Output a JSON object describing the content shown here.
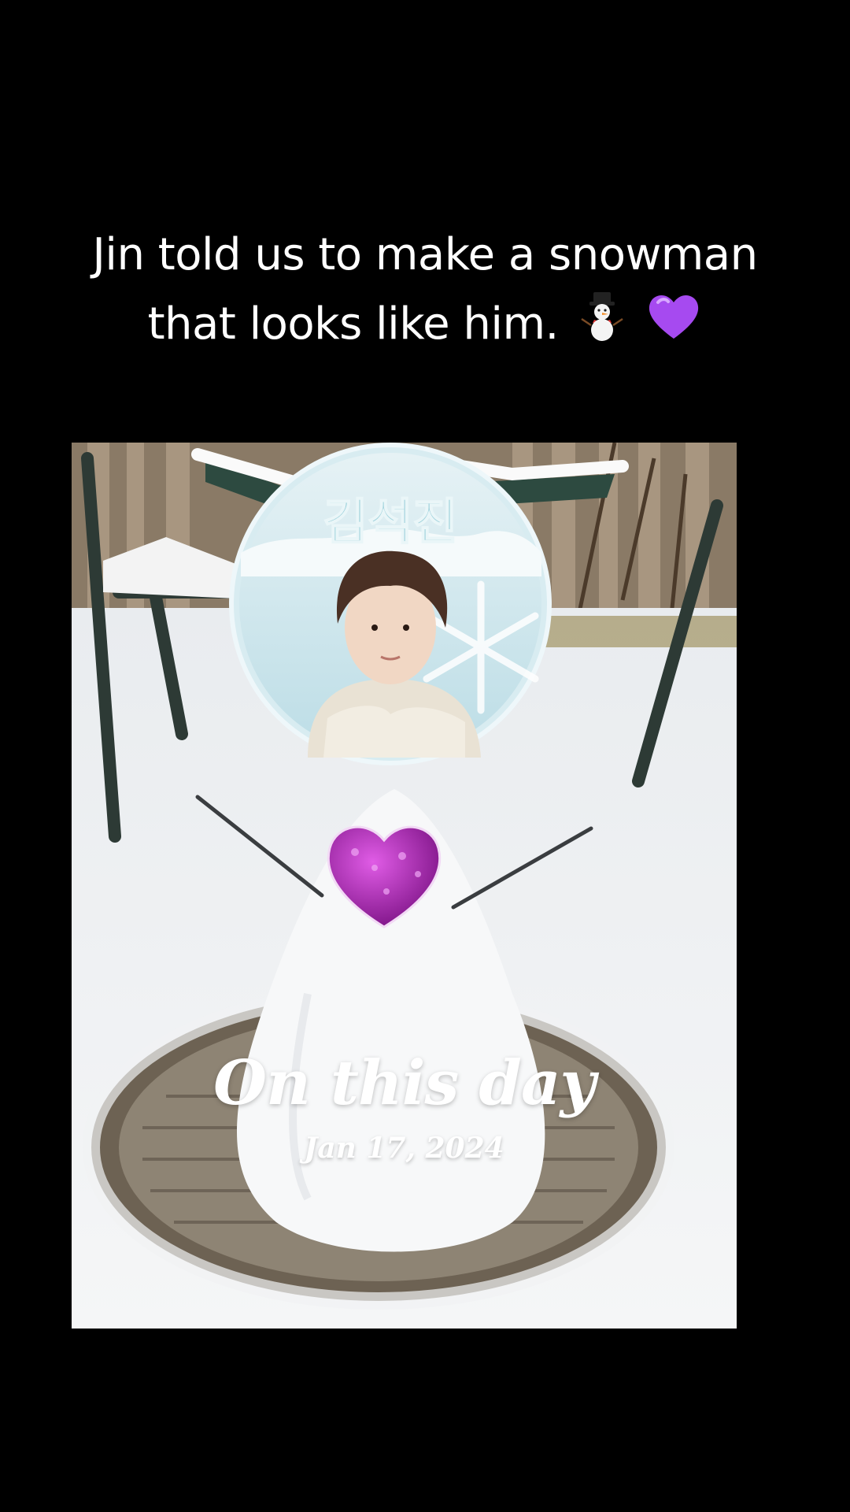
{
  "caption": {
    "line1": "Jin told us to make a snowman",
    "line2": "that looks like him."
  },
  "icons": {
    "caption_emoji_1": "snowman-icon",
    "caption_emoji_2": "purple-heart-icon"
  },
  "photo": {
    "sign_logo_text": "김석진",
    "overlay_title": "On this day",
    "overlay_date": "Jan 17, 2024"
  },
  "colors": {
    "background": "#000000",
    "caption_text": "#ffffff",
    "heart_accent": "#a21caf",
    "sign_blue": "#bfe3ee"
  }
}
